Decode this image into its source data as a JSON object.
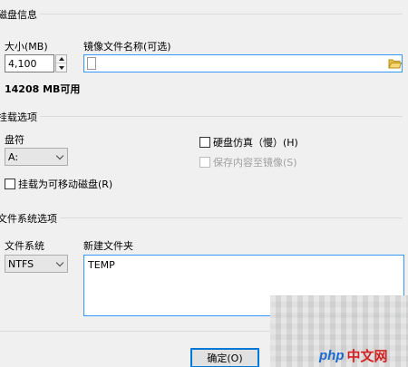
{
  "disk_info": {
    "group_title": "磁盘信息",
    "size_label": "大小(MB)",
    "size_value": "4,100",
    "available": "14208 MB可用",
    "image_label": "镜像文件名称(可选)",
    "image_value": ""
  },
  "mount_options": {
    "group_title": "挂载选项",
    "drive_label": "盘符",
    "drive_value": "A:",
    "hdd_emulation": "硬盘仿真（慢）(H)",
    "save_to_image": "保存内容至镜像(S)",
    "removable": "挂载为可移动磁盘(R)"
  },
  "filesystem": {
    "group_title": "文件系统选项",
    "fs_label": "文件系统",
    "fs_value": "NTFS",
    "new_folder_label": "新建文件夹",
    "new_folder_value": "TEMP"
  },
  "buttons": {
    "ok": "确定(O)"
  },
  "watermark": {
    "logo": "php",
    "site": "中文网"
  },
  "colors": {
    "accent": "#0078d7",
    "focus_border": "#3399ff"
  }
}
